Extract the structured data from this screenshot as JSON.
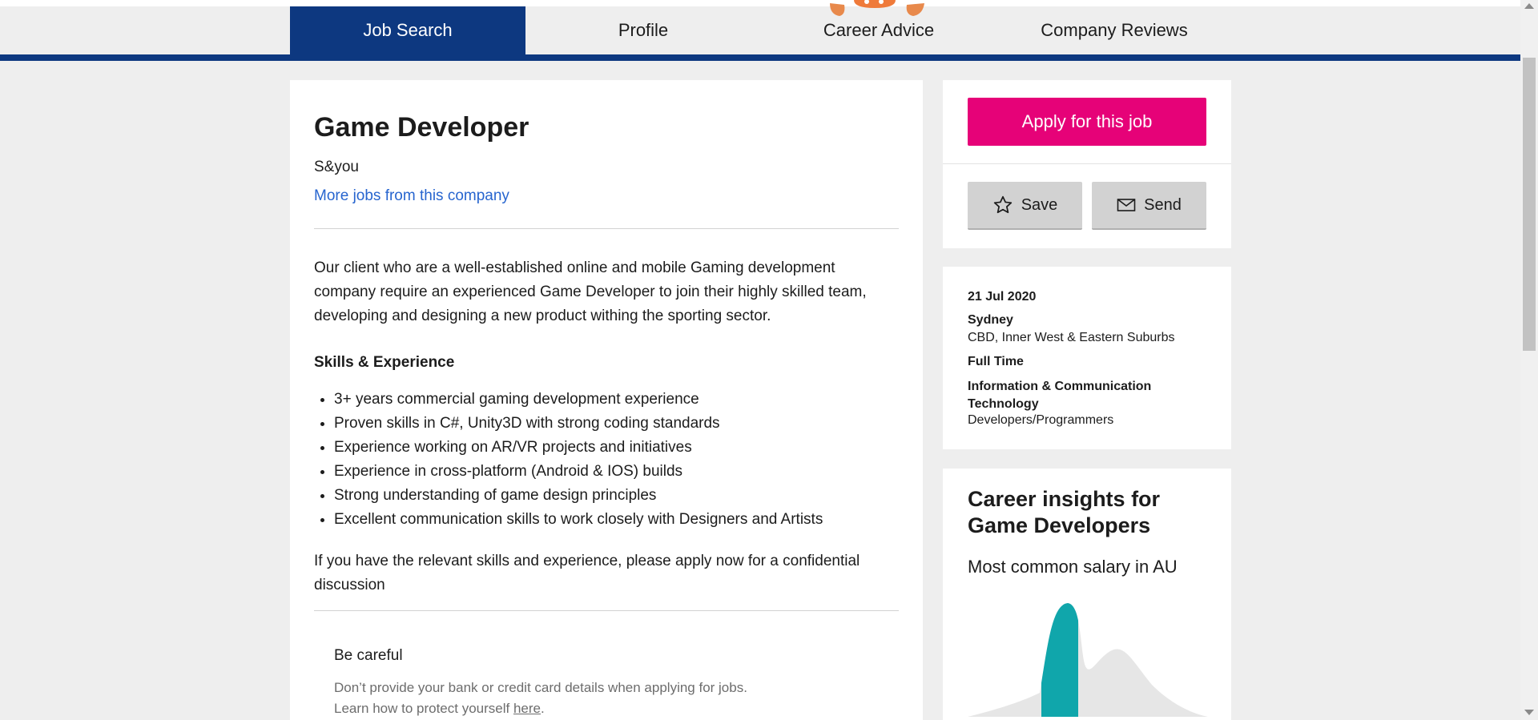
{
  "nav": {
    "tabs": [
      {
        "label": "Job Search"
      },
      {
        "label": "Profile"
      },
      {
        "label": "Career Advice"
      },
      {
        "label": "Company Reviews"
      }
    ],
    "active_color": "#0d3880"
  },
  "job": {
    "title": "Game Developer",
    "company": "S&you",
    "more_jobs_link": "More jobs from this company",
    "description": "Our client who are a well-established online and mobile Gaming development company require an experienced Game Developer to join their highly skilled team, developing and designing a new product withing the sporting sector.",
    "skills_heading": "Skills & Experience",
    "skills": [
      "3+ years commercial gaming development experience",
      "Proven skills in C#, Unity3D with strong coding standards",
      "Experience working on AR/VR projects and initiatives",
      "Experience in cross-platform (Android & IOS) builds",
      "Strong understanding of game design principles",
      "Excellent communication skills to work closely with Designers and Artists"
    ],
    "closing": "If you have the relevant skills and experience, please apply now for a confidential discussion"
  },
  "warning": {
    "heading": "Be careful",
    "line1": "Don’t provide your bank or credit card details when applying for jobs.",
    "line2_prefix": "Learn how to protect yourself ",
    "link": "here",
    "line2_suffix": "."
  },
  "actions": {
    "apply_label": "Apply for this job",
    "apply_color": "#e60278",
    "save_label": "Save",
    "send_label": "Send"
  },
  "details": {
    "date": "21 Jul 2020",
    "location": "Sydney",
    "area": "CBD, Inner West & Eastern Suburbs",
    "work_type": "Full Time",
    "classification": "Information & Communication Technology",
    "sub_classification": "Developers/Programmers"
  },
  "insights": {
    "heading": "Career insights for Game Developers",
    "subheading": "Most common salary in AU",
    "chart_color": "#10a6ab"
  }
}
